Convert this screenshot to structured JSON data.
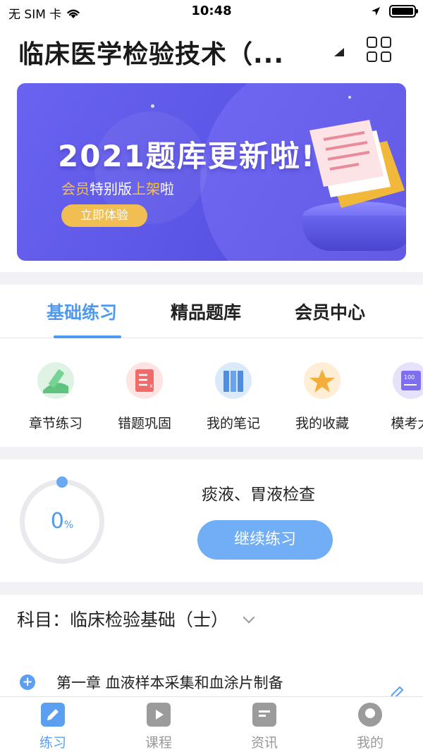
{
  "status_bar": {
    "carrier": "无 SIM 卡",
    "time": "10:48"
  },
  "header": {
    "title": "临床医学检验技术（..."
  },
  "banner": {
    "headline": "2021题库更新啦!",
    "sub_prefix": "会员",
    "sub_middle": "特别版",
    "sub_highlight": "上架",
    "sub_suffix": "啦",
    "cta": "立即体验",
    "colors": {
      "background": "#5b55e6",
      "accent": "#f0be52"
    }
  },
  "tabs": [
    {
      "label": "基础练习",
      "active": true
    },
    {
      "label": "精品题库",
      "active": false
    },
    {
      "label": "会员中心",
      "active": false
    }
  ],
  "quick_actions": [
    {
      "label": "章节练习",
      "icon": "pencil-icon",
      "color": "#5fc27e"
    },
    {
      "label": "错题巩固",
      "icon": "error-list-icon",
      "color": "#ee6b6b"
    },
    {
      "label": "我的笔记",
      "icon": "books-icon",
      "color": "#4e8de0"
    },
    {
      "label": "我的收藏",
      "icon": "star-icon",
      "color": "#f3ae3c"
    },
    {
      "label": "模考大",
      "icon": "exam-paper-icon",
      "color": "#7d6ff0"
    }
  ],
  "progress": {
    "value": "0",
    "unit": "%",
    "fraction": 0,
    "topic": "痰液、胃液检查",
    "continue_label": "继续练习"
  },
  "subject": {
    "label": "科目：临床检验基础（士）"
  },
  "chapter": {
    "title": "第一章  血液样本采集和血涂片制备"
  },
  "bottom_nav": [
    {
      "label": "练习",
      "icon": "edit-icon",
      "active": true
    },
    {
      "label": "课程",
      "icon": "video-icon",
      "active": false
    },
    {
      "label": "资讯",
      "icon": "news-icon",
      "active": false
    },
    {
      "label": "我的",
      "icon": "user-icon",
      "active": false
    }
  ],
  "colors": {
    "primary": "#4e9af0",
    "button": "#72aef5"
  }
}
